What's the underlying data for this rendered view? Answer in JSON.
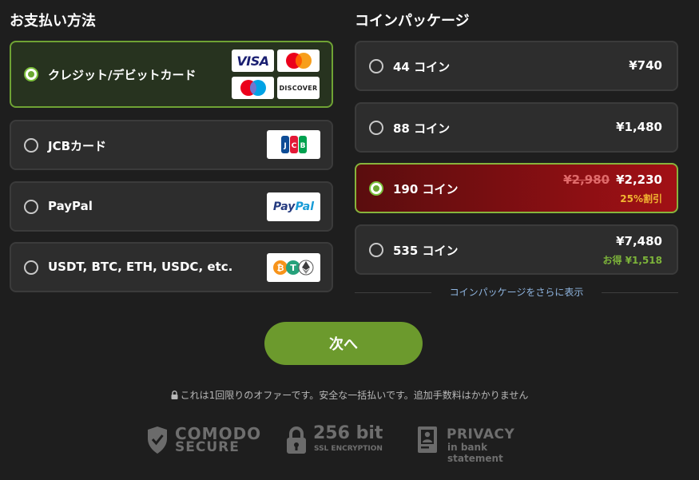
{
  "payment": {
    "title": "お支払い方法",
    "methods": [
      {
        "label": "クレジット/デビットカード"
      },
      {
        "label": "JCBカード"
      },
      {
        "label": "PayPal"
      },
      {
        "label": "USDT, BTC, ETH, USDC, etc."
      }
    ],
    "logos": {
      "visa": "VISA",
      "discover": "DISCOVER",
      "paypal_a": "Pay",
      "paypal_b": "Pal"
    }
  },
  "packages": {
    "title": "コインパッケージ",
    "items": [
      {
        "label": "44 コイン",
        "price": "¥740"
      },
      {
        "label": "88 コイン",
        "price": "¥1,480"
      },
      {
        "label": "190 コイン",
        "old_price": "¥2,980",
        "price": "¥2,230",
        "note": "25%割引"
      },
      {
        "label": "535 コイン",
        "price": "¥7,480",
        "note": "お得 ¥1,518"
      }
    ],
    "more_link": "コインパッケージをさらに表示"
  },
  "next_button": "次へ",
  "notice": "これは1回限りのオファーです。安全な一括払いです。追加手数料はかかりません",
  "trust": {
    "comodo_top": "COMODO",
    "comodo_bottom": "SECURE",
    "ssl_big": "256 bit",
    "ssl_small": "SSL ENCRYPTION",
    "privacy_big": "PRIVACY",
    "privacy_small": "in bank statement"
  },
  "colors": {
    "background": "#1e1e1e",
    "card": "#2d2d2d",
    "accent_green": "#6c9a2d",
    "selected_pkg_red": "#a21015",
    "discount_yellow": "#f2b632",
    "savings_green": "#7db43a"
  }
}
